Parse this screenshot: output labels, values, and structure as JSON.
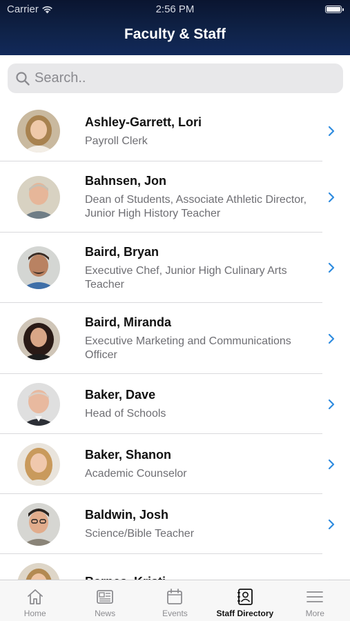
{
  "status_bar": {
    "carrier": "Carrier",
    "time": "2:56 PM"
  },
  "header": {
    "title": "Faculty & Staff"
  },
  "search": {
    "placeholder": "Search.."
  },
  "staff": [
    {
      "name": "Ashley-Garrett, Lori",
      "role": "Payroll Clerk"
    },
    {
      "name": "Bahnsen, Jon",
      "role": "Dean of Students, Associate Athletic Director, Junior High History Teacher"
    },
    {
      "name": "Baird, Bryan",
      "role": "Executive Chef, Junior High Culinary Arts Teacher"
    },
    {
      "name": "Baird, Miranda",
      "role": "Executive Marketing and Communications Officer"
    },
    {
      "name": "Baker, Dave",
      "role": "Head of Schools"
    },
    {
      "name": "Baker, Shanon",
      "role": "Academic Counselor"
    },
    {
      "name": "Baldwin, Josh",
      "role": "Science/Bible Teacher"
    },
    {
      "name": "Barnes, Kristi",
      "role": ""
    }
  ],
  "tabbar": {
    "active_index": 3,
    "tabs": [
      {
        "label": "Home",
        "icon": "home-icon"
      },
      {
        "label": "News",
        "icon": "news-icon"
      },
      {
        "label": "Events",
        "icon": "calendar-icon"
      },
      {
        "label": "Staff Directory",
        "icon": "contact-card-icon"
      },
      {
        "label": "More",
        "icon": "menu-icon"
      }
    ]
  },
  "colors": {
    "header": "#0f2247",
    "accent": "#2f8cdf",
    "separator": "#d9d9dc"
  }
}
